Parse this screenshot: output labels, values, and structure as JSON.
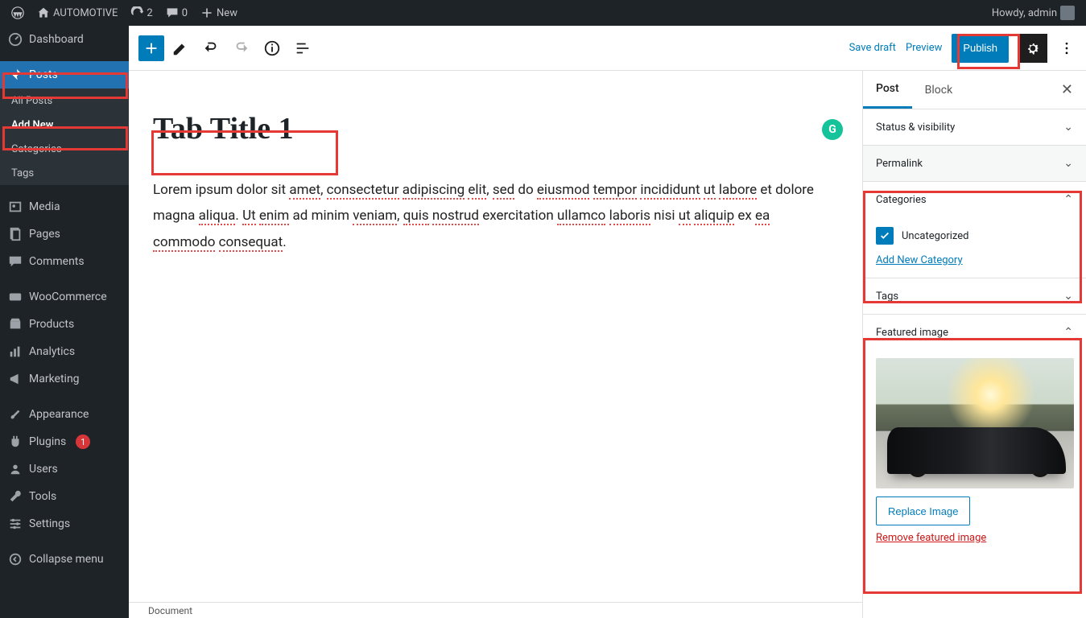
{
  "adminbar": {
    "site_name": "AUTOMOTIVE",
    "updates_count": "2",
    "comments_count": "0",
    "new_label": "New",
    "howdy": "Howdy, admin"
  },
  "sidebar": {
    "dashboard": "Dashboard",
    "posts": "Posts",
    "posts_sub": {
      "all_posts": "All Posts",
      "add_new": "Add New",
      "categories": "Categories",
      "tags": "Tags"
    },
    "media": "Media",
    "pages": "Pages",
    "comments": "Comments",
    "woocommerce": "WooCommerce",
    "products": "Products",
    "analytics": "Analytics",
    "marketing": "Marketing",
    "appearance": "Appearance",
    "plugins": "Plugins",
    "plugins_badge": "1",
    "users": "Users",
    "tools": "Tools",
    "settings": "Settings",
    "collapse": "Collapse menu"
  },
  "toolbar": {
    "save_draft": "Save draft",
    "preview": "Preview",
    "publish": "Publish"
  },
  "editor": {
    "title": "Tab Title 1",
    "paragraph_prefix": "Lorem ipsum dolor sit ",
    "w1": "amet",
    "s1": ", ",
    "w2": "consectetur",
    "s2": " ",
    "w3": "adipiscing",
    "s3": " ",
    "w4": "elit",
    "s4": ", ",
    "w5": "sed",
    "s5": " do ",
    "w6": "eiusmod",
    "s6": " ",
    "w7": "tempor",
    "s7": " ",
    "w8": "incididunt",
    "s8": " ",
    "w9": "ut",
    "s9": " ",
    "w10": "labore",
    "s10": " et dolore magna ",
    "w11": "aliqua",
    "s11": ". ",
    "w12": "Ut",
    "s12": " ",
    "w13": "enim",
    "s13": " ad minim ",
    "w14": "veniam",
    "s14": ", ",
    "w15": "quis",
    "s15": " ",
    "w16": "nostrud",
    "s16": " exercitation ",
    "w17": "ullamco",
    "s17": " ",
    "w18": "laboris",
    "s18": " nisi ",
    "w19": "ut",
    "s19": " ",
    "w20": "aliquip",
    "s20": " ex ",
    "w21": "ea",
    "s21": " ",
    "w22": "commodo",
    "s22": " ",
    "w23": "consequat",
    "s23": ".",
    "grammarly_glyph": "G"
  },
  "settings": {
    "tab_post": "Post",
    "tab_block": "Block",
    "status_visibility": "Status & visibility",
    "permalink": "Permalink",
    "categories": "Categories",
    "category_item": "Uncategorized",
    "add_new_category": "Add New Category",
    "tags": "Tags",
    "featured_image": "Featured image",
    "replace_image": "Replace Image",
    "remove_featured": "Remove featured image"
  },
  "footer": {
    "breadcrumb": "Document"
  }
}
